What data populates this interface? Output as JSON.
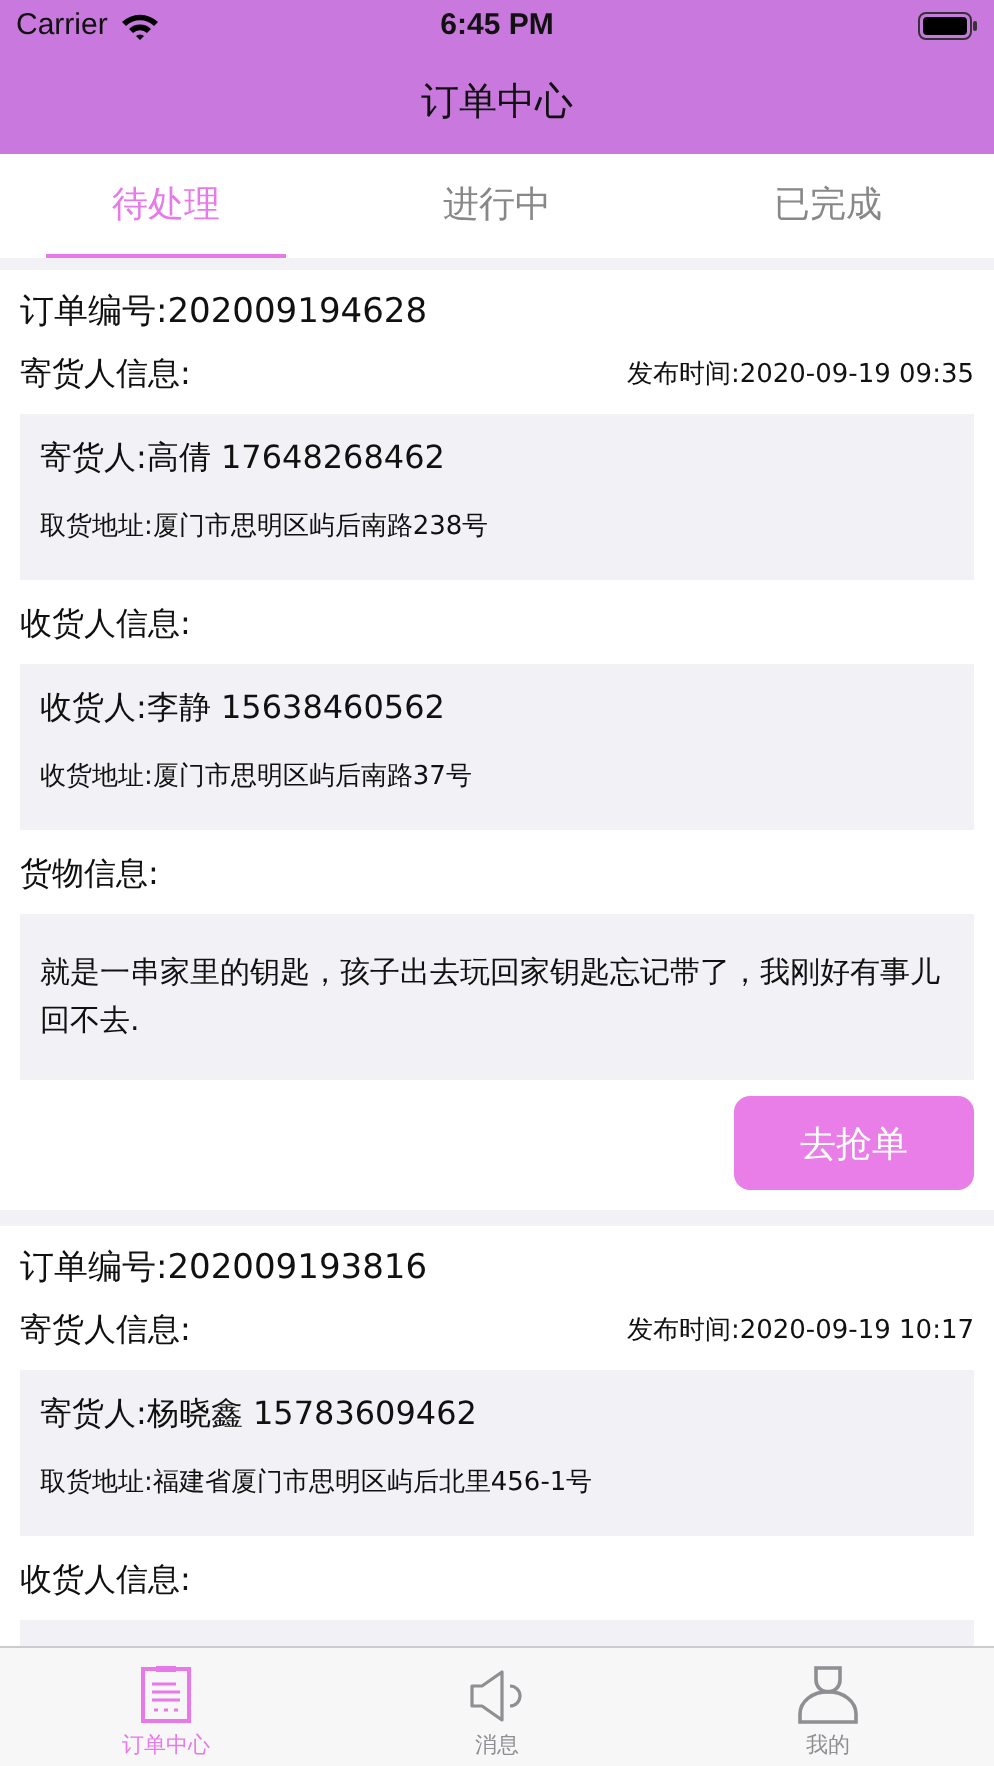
{
  "status_bar": {
    "carrier": "Carrier",
    "time": "6:45 PM"
  },
  "nav_bar": {
    "title": "订单中心"
  },
  "tabs": [
    {
      "label": "待处理",
      "selected": true
    },
    {
      "label": "进行中",
      "selected": false
    },
    {
      "label": "已完成",
      "selected": false
    }
  ],
  "orders": [
    {
      "order_number": "订单编号:202009194628",
      "sender_heading": "寄货人信息:",
      "publish_time": "发布时间:2020-09-19 09:35",
      "sender": {
        "contact": "寄货人:高倩 17648268462",
        "address": "取货地址:厦门市思明区屿后南路238号"
      },
      "receiver_heading": "收货人信息:",
      "receiver": {
        "contact": "收货人:李静 15638460562",
        "address": "收货地址:厦门市思明区屿后南路37号"
      },
      "goods_heading": "货物信息:",
      "goods_description": "就是一串家里的钥匙，孩子出去玩回家钥匙忘记带了，我刚好有事儿回不去.",
      "action_button": "去抢单"
    },
    {
      "order_number": "订单编号:202009193816",
      "sender_heading": "寄货人信息:",
      "publish_time": "发布时间:2020-09-19 10:17",
      "sender": {
        "contact": "寄货人:杨晓鑫 15783609462",
        "address": "取货地址:福建省厦门市思明区屿后北里456-1号"
      },
      "receiver_heading": "收货人信息:"
    }
  ],
  "tab_bar": [
    {
      "kind": "orders",
      "label": "订单中心",
      "selected": true
    },
    {
      "kind": "messages",
      "label": "消息",
      "selected": false
    },
    {
      "kind": "profile",
      "label": "我的",
      "selected": false
    }
  ]
}
